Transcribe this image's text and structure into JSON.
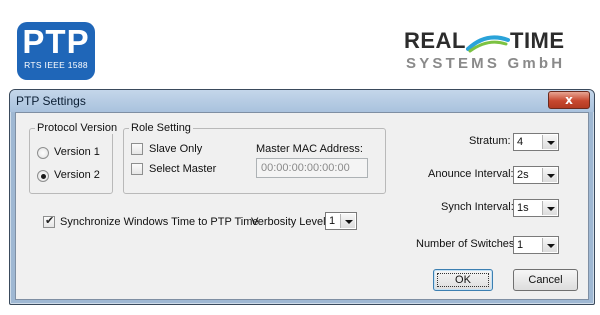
{
  "branding": {
    "ptp_logo_main": "PTP",
    "ptp_logo_sub": "RTS IEEE 1588",
    "rts_logo_line1_a": "REAL",
    "rts_logo_line1_b": "TIME",
    "rts_logo_line2": "SYSTEMS GmbH",
    "ptp_logo_color": "#1f66b8"
  },
  "window": {
    "title": "PTP Settings",
    "close_icon": "close-icon",
    "close_glyph": "x"
  },
  "protocol_version": {
    "group_title": "Protocol Version",
    "options": [
      {
        "label": "Version 1",
        "checked": false
      },
      {
        "label": "Version 2",
        "checked": true
      }
    ]
  },
  "role_setting": {
    "group_title": "Role Setting",
    "slave_only_label": "Slave Only",
    "slave_only_checked": false,
    "select_master_label": "Select Master",
    "select_master_checked": false,
    "master_mac_label": "Master MAC Address:",
    "master_mac_placeholder": "00:00:00:00:00:00"
  },
  "sync_windows_time": {
    "label": "Synchronize Windows Time to PTP Time",
    "checked": true
  },
  "verbosity": {
    "label": "Verbosity Level:",
    "value": "1"
  },
  "right_panel": {
    "stratum_label": "Stratum:",
    "stratum_value": "4",
    "announce_label": "Anounce Interval:",
    "announce_value": "2s",
    "synch_label": "Synch Interval:",
    "synch_value": "1s",
    "switches_label": "Number of Switches:",
    "switches_value": "1"
  },
  "buttons": {
    "ok_label": "OK",
    "cancel_label": "Cancel"
  }
}
